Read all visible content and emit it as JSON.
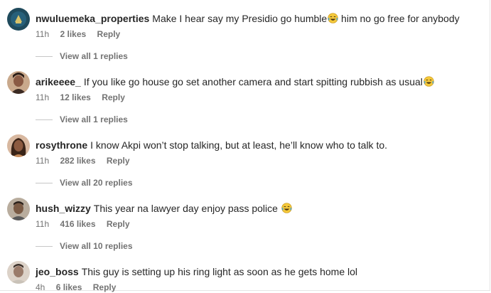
{
  "comments": [
    {
      "username": "nwuluemeka_properties",
      "text": "Make I hear say my Presidio go humble",
      "text2": " him no go free for anybody",
      "time": "11h",
      "likes": "2 likes",
      "reply": "Reply",
      "view_replies": "View all 1 replies",
      "avatar_color": "#1f4a5c",
      "emoji": "face-with-tears-of-joy"
    },
    {
      "username": "arikeeee_",
      "text": "If you like go house go set another camera and start spitting rubbish as usual",
      "time": "11h",
      "likes": "12 likes",
      "reply": "Reply",
      "view_replies": "View all 1 replies",
      "avatar_color": "#8a5a44",
      "emoji": "face-with-tears-of-joy"
    },
    {
      "username": "rosythrone",
      "text": "I know Akpi won’t stop talking, but at least, he’ll know who to talk to.",
      "time": "11h",
      "likes": "282 likes",
      "reply": "Reply",
      "view_replies": "View all 20 replies",
      "avatar_color": "#6b3f2e"
    },
    {
      "username": "hush_wizzy",
      "text": "This year na lawyer day enjoy pass police ",
      "time": "11h",
      "likes": "416 likes",
      "reply": "Reply",
      "view_replies": "View all 10 replies",
      "avatar_color": "#7a6a58",
      "emoji": "face-with-tears-of-joy"
    },
    {
      "username": "jeo_boss",
      "text": "This guy is setting up his ring light as soon as he gets home lol",
      "time": "4h",
      "likes": "6 likes",
      "reply": "Reply",
      "avatar_color": "#9a7b6a"
    }
  ]
}
